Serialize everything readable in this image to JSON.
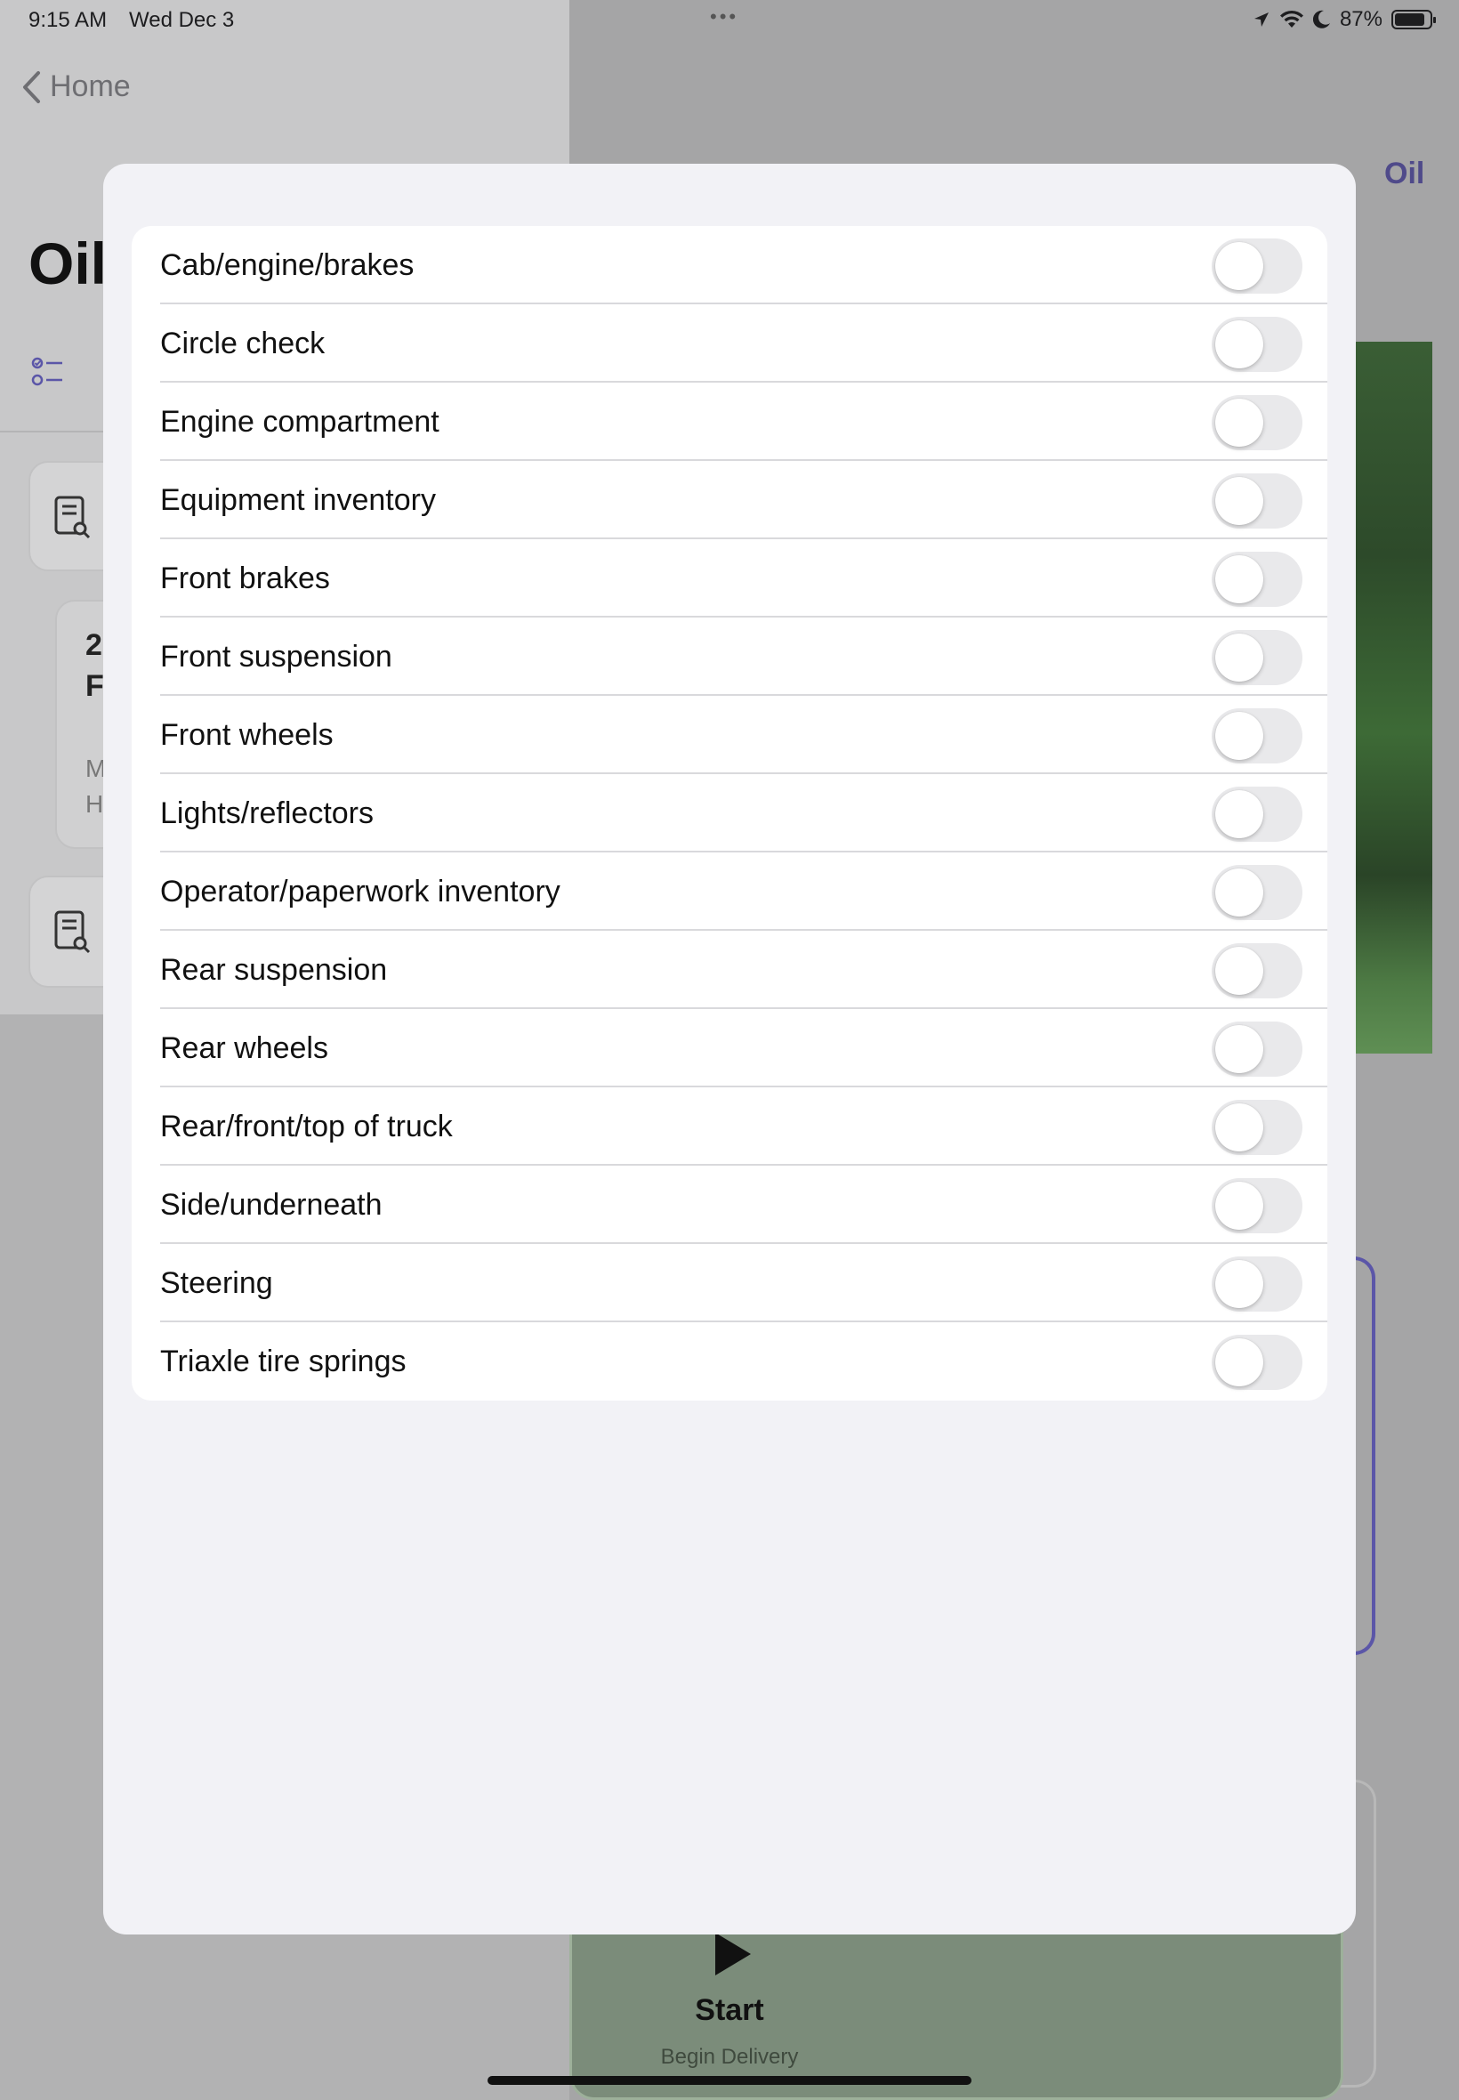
{
  "status_bar": {
    "time": "9:15 AM",
    "date": "Wed Dec 3",
    "battery": "87%",
    "battery_level": 0.87
  },
  "background": {
    "back_label": "Home",
    "title": "Oil",
    "top_right_link": "Oil",
    "card_line1": "2",
    "card_line2": "F",
    "card_line3": "M",
    "card_line4": "H",
    "start_label": "Start",
    "start_sub": "Begin Delivery"
  },
  "checklist": {
    "items": [
      {
        "label": "Cab/engine/brakes",
        "on": false
      },
      {
        "label": "Circle check",
        "on": false
      },
      {
        "label": "Engine compartment",
        "on": false
      },
      {
        "label": "Equipment inventory",
        "on": false
      },
      {
        "label": "Front brakes",
        "on": false
      },
      {
        "label": "Front suspension",
        "on": false
      },
      {
        "label": "Front wheels",
        "on": false
      },
      {
        "label": "Lights/reflectors",
        "on": false
      },
      {
        "label": "Operator/paperwork inventory",
        "on": false
      },
      {
        "label": "Rear suspension",
        "on": false
      },
      {
        "label": "Rear wheels",
        "on": false
      },
      {
        "label": "Rear/front/top of truck",
        "on": false
      },
      {
        "label": "Side/underneath",
        "on": false
      },
      {
        "label": "Steering",
        "on": false
      },
      {
        "label": "Triaxle tire springs",
        "on": false
      }
    ]
  },
  "colors": {
    "accent": "#4f4a8a",
    "toggle_off": "#e9e9eb",
    "sheet_bg": "#f2f2f6"
  }
}
